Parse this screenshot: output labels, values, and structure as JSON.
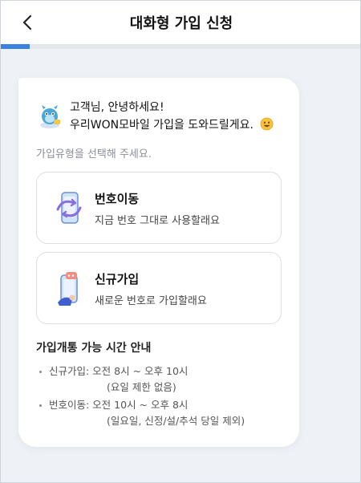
{
  "header": {
    "title": "대화형 가입 신청",
    "back_icon": "chevron-left-icon"
  },
  "progress": {
    "value_percent": 8,
    "color": "#3b82e0"
  },
  "chat": {
    "avatar_icon": "bot-mascot-icon",
    "greeting_line1": "고객님, 안녕하세요!",
    "greeting_line2": "우리WON모바일 가입을 도와드릴게요.",
    "greeting_emoji": "smiling-face-icon",
    "prompt": "가입유형을 선택해 주세요.",
    "options": [
      {
        "title": "번호이동",
        "subtitle": "지금 번호 그대로 사용할래요",
        "icon": "number-transfer-phone-icon"
      },
      {
        "title": "신규가입",
        "subtitle": "새로운 번호로 가입할래요",
        "icon": "new-signup-phone-icon"
      }
    ],
    "hours": {
      "title": "가입개통 가능 시간 안내",
      "items": [
        {
          "label": "신규가입: 오전 8시 ~ 오후 10시",
          "note": "(요일 제한 없음)"
        },
        {
          "label": "번호이동: 오전 10시 ~ 오후 8시",
          "note": "(일요일, 신정/설/추석 당일 제외)"
        }
      ]
    }
  }
}
